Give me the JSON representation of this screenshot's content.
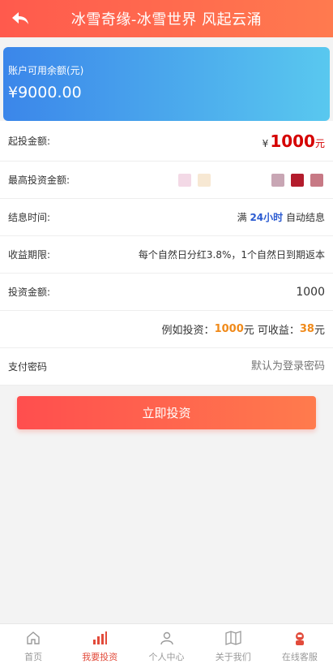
{
  "header": {
    "title": "冰雪奇缘-冰雪世界 风起云涌"
  },
  "balance": {
    "label": "账户可用余额(元)",
    "amount": "¥9000.00"
  },
  "rows": {
    "min_invest": {
      "label": "起投金额:",
      "yen": "¥",
      "value": "1000",
      "unit": "元"
    },
    "max_invest": {
      "label": "最高投资金额:"
    },
    "settle": {
      "label": "结息时间:",
      "prefix": "满",
      "hours": "24小时",
      "suffix": "自动结息"
    },
    "period": {
      "label": "收益期限:",
      "value": "每个自然日分红3.8%，1个自然日到期返本"
    },
    "amount": {
      "label": "投资金额:",
      "value": "1000"
    },
    "example": {
      "prefix": "例如投资：",
      "invest": "1000",
      "mid": " 元 可收益：",
      "profit": "38",
      "unit": "元"
    },
    "password": {
      "label": "支付密码",
      "placeholder": "默认为登录密码"
    }
  },
  "invest_button": "立即投资",
  "tabs": [
    {
      "label": "首页",
      "icon": "home-icon",
      "active": false
    },
    {
      "label": "我要投资",
      "icon": "chart-bars-icon",
      "active": true
    },
    {
      "label": "个人中心",
      "icon": "person-icon",
      "active": false
    },
    {
      "label": "关于我们",
      "icon": "book-icon",
      "active": false
    },
    {
      "label": "在线客服",
      "icon": "support-agent-icon",
      "active": false
    }
  ],
  "colors": {
    "accent": "#ff5a4d",
    "balance_start": "#3b86ea",
    "balance_end": "#59c8ef",
    "tab_active": "#e24b3b"
  }
}
